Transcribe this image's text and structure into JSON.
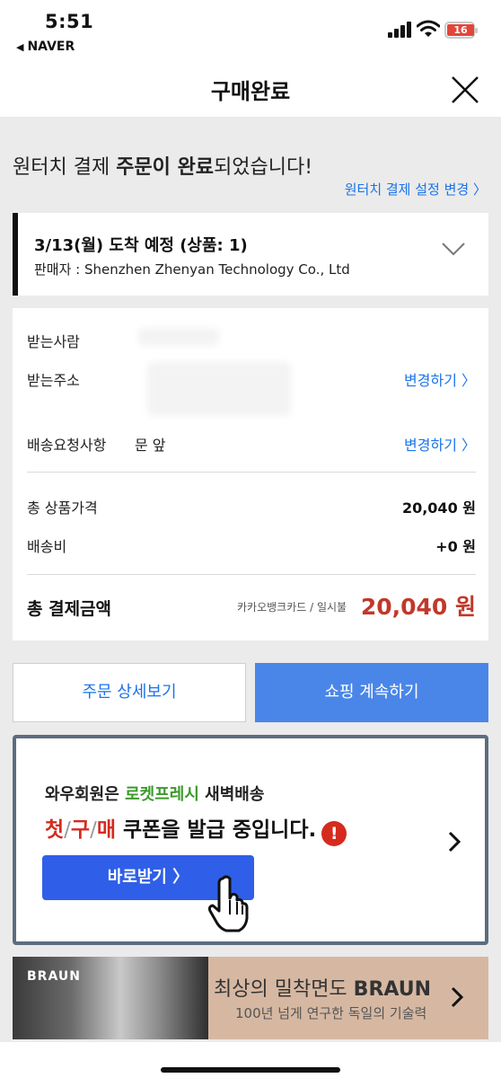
{
  "status_bar": {
    "time": "5:51",
    "back_app": "NAVER",
    "battery": "16"
  },
  "header": {
    "title": "구매완료"
  },
  "headline": {
    "prefix": "원터치 결제 ",
    "bold": "주문이 완료",
    "suffix": "되었습니다!",
    "settings_link": "원터치 결제 설정 변경 〉"
  },
  "delivery": {
    "eta": "3/13(월) 도착 예정 (상품: 1)",
    "seller": "판매자 : Shenzhen Zhenyan Technology Co., Ltd"
  },
  "order_info": {
    "recipient_label": "받는사람",
    "address_label": "받는주소",
    "address_change": "변경하기 〉",
    "request_label": "배송요청사항",
    "request_value": "문 앞",
    "request_change": "변경하기 〉",
    "subtotal_label": "총 상품가격",
    "subtotal_value": "20,040 원",
    "shipping_label": "배송비",
    "shipping_value": "+0 원",
    "total_label": "총 결제금액",
    "payment_method": "카카오뱅크카드 / 일시불",
    "total_value": "20,040 원"
  },
  "buttons": {
    "order_detail": "주문 상세보기",
    "continue_shopping": "쇼핑 계속하기"
  },
  "promo": {
    "line1_prefix": "와우회원은 ",
    "line1_green": "로켓프레시",
    "line1_suffix": " 새벽배송",
    "line2_c1": "첫",
    "line2_c2": "구",
    "line2_c3": "매",
    "line2_sep": "/",
    "line2_rest": " 쿠폰을 발급 중입니다.",
    "alert_mark": "!",
    "cta": "바로받기 〉"
  },
  "braun_banner": {
    "logo": "BRAUN",
    "line1_prefix": "최상의 밀착면도 ",
    "line1_bold": "BRAUN",
    "line2": "100년 넘게 연구한 독일의 기술력"
  }
}
